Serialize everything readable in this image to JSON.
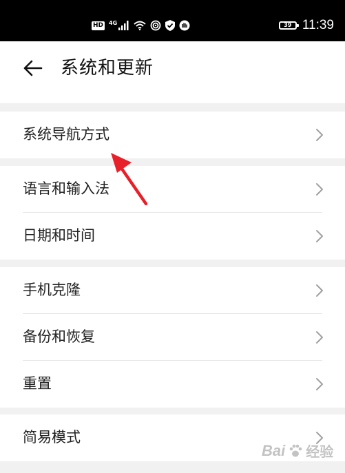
{
  "status_bar": {
    "hd": "HD",
    "network": "4G",
    "battery": "39",
    "time": "11:39"
  },
  "header": {
    "title": "系统和更新",
    "back_icon": "arrow-left-icon"
  },
  "groups": [
    {
      "items": [
        {
          "label": "系统导航方式"
        }
      ]
    },
    {
      "items": [
        {
          "label": "语言和输入法"
        },
        {
          "label": "日期和时间"
        }
      ]
    },
    {
      "items": [
        {
          "label": "手机克隆"
        },
        {
          "label": "备份和恢复"
        },
        {
          "label": "重置"
        }
      ]
    },
    {
      "items": [
        {
          "label": "简易模式"
        }
      ]
    }
  ],
  "colors": {
    "background": "#f1f1f1",
    "card": "#ffffff",
    "text": "#222222",
    "chevron": "#a0a0a0",
    "annotation_arrow": "#e8202a"
  },
  "watermark": {
    "brand": "Bai",
    "cn": "经验"
  }
}
